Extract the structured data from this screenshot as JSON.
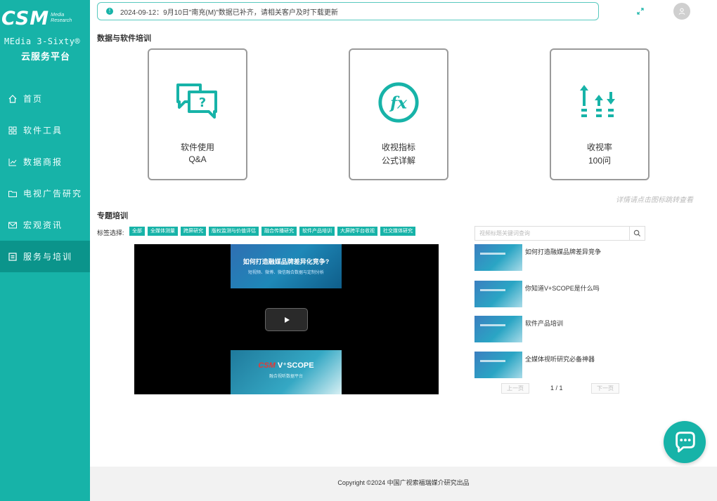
{
  "brand": {
    "logo": "CSM",
    "logo_sub_line1": "Media",
    "logo_sub_line2": "Research",
    "tagline": "MEdia 3-Sixty®",
    "platform": "云服务平台"
  },
  "sidebar": {
    "items": [
      {
        "label": "首页",
        "icon": "home-icon"
      },
      {
        "label": "软件工具",
        "icon": "grid-icon"
      },
      {
        "label": "数据商报",
        "icon": "chart-icon"
      },
      {
        "label": "电视广告研究",
        "icon": "folder-icon"
      },
      {
        "label": "宏观资讯",
        "icon": "mail-icon"
      },
      {
        "label": "服务与培训",
        "icon": "board-icon",
        "active": true
      }
    ]
  },
  "notice": {
    "text": "2024-09-12：9月10日\"南充(M)\"数据已补齐，请相关客户及时下载更新",
    "icon": "info-icon"
  },
  "section1_title": "数据与软件培训",
  "cards": [
    {
      "line1": "软件使用",
      "line2": "Q&A",
      "icon": "qa-icon"
    },
    {
      "line1": "收视指标",
      "line2": "公式详解",
      "icon": "fx-icon"
    },
    {
      "line1": "收视率",
      "line2": "100问",
      "icon": "arrows-icon"
    }
  ],
  "hint": "详情请点击图标跳转查看",
  "section2_title": "专题培训",
  "tag_label": "标签选择:",
  "tags": [
    "全部",
    "全媒体测量",
    "跨屏研究",
    "版权监测与价值评估",
    "融合传播研究",
    "软件产品培训",
    "大屏跨平台收视",
    "社交媒体研究"
  ],
  "video": {
    "top_title": "如何打造融媒品牌差异化竞争?",
    "top_sub": "短视频、微博、微信融合数据与定制分析",
    "bottom_brand_a": "CSM",
    "bottom_brand_b": "V⁺SCOPE",
    "bottom_sub": "融合视听数据平台"
  },
  "search": {
    "placeholder": "视频标题关键词查询"
  },
  "videos": [
    {
      "title": "如何打造融媒品牌差异竞争"
    },
    {
      "title": "你知道V+SCOPE是什么吗"
    },
    {
      "title": "软件产品培训"
    },
    {
      "title": "全媒体视听研究必备神器"
    }
  ],
  "pager": {
    "prev": "上一页",
    "current": "1 / 1",
    "next": "下一页"
  },
  "footer": "Copyright ©2024 中国广视索福瑞媒介研究出品",
  "colors": {
    "accent": "#17b3a8",
    "accent_dark": "#0b948b"
  }
}
